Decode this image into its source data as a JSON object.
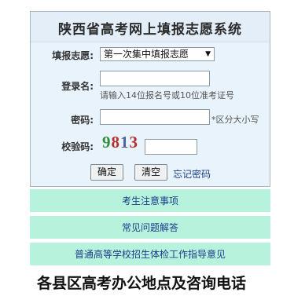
{
  "panel": {
    "title": "陕西省高考网上填报志愿系统"
  },
  "form": {
    "batch_label": "填报志愿:",
    "batch_selected": "第一次集中填报志愿",
    "login_label": "登录名:",
    "login_value": "",
    "login_hint": "请输入14位报名号或10位准考证号",
    "password_label": "密码:",
    "password_value": "",
    "password_hint": "*区分大小写",
    "captcha_label": "校验码:",
    "captcha_digits": [
      "9",
      "8",
      "1",
      "3"
    ],
    "captcha_value": "",
    "confirm_button": "确定",
    "clear_button": "清空",
    "forgot_link": "忘记密码"
  },
  "links": {
    "notes": "考生注意事项",
    "faq": "常见问题解答",
    "health_guide": "普通高等学校招生体检工作指导意见"
  },
  "footer": {
    "heading": "各县区高考办公地点及咨询电话"
  },
  "colors": {
    "panel_bg": "#e9f3fb",
    "link_row_bg": "#b7f2dc",
    "link_color": "#1a3d8a"
  }
}
